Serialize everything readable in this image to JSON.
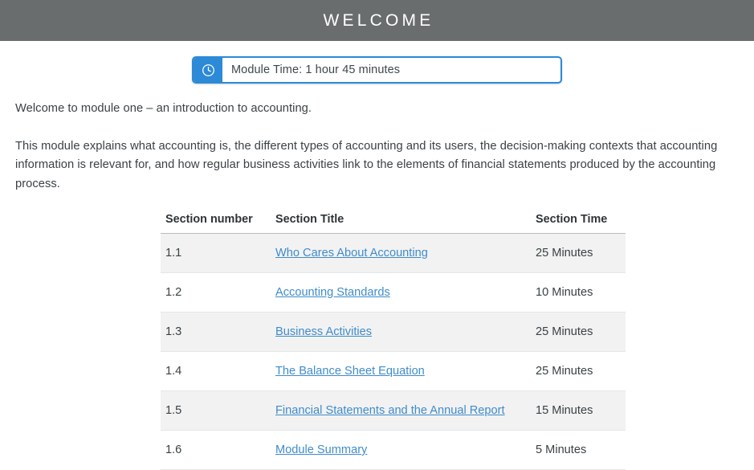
{
  "header": {
    "title": "WELCOME"
  },
  "module_time": {
    "icon": "clock-icon",
    "label": "Module Time: 1 hour 45 minutes"
  },
  "intro": {
    "paragraph_1": "Welcome to module one – an introduction to accounting.",
    "paragraph_2": "This module explains what accounting is, the different types of accounting and its users, the decision-making contexts that accounting information is relevant for, and how regular business activities link to the elements of financial statements produced by the accounting process."
  },
  "sections_table": {
    "columns": [
      "Section number",
      "Section Title",
      "Section Time"
    ],
    "rows": [
      {
        "number": "1.1",
        "title": "Who Cares About Accounting",
        "time": "25 Minutes"
      },
      {
        "number": "1.2",
        "title": "Accounting Standards",
        "time": "10 Minutes"
      },
      {
        "number": "1.3",
        "title": "Business Activities",
        "time": "25 Minutes"
      },
      {
        "number": "1.4",
        "title": "The Balance Sheet Equation",
        "time": "25 Minutes"
      },
      {
        "number": "1.5",
        "title": "Financial Statements and the Annual Report",
        "time": "15 Minutes"
      },
      {
        "number": "1.6",
        "title": "Module Summary",
        "time": "5 Minutes"
      }
    ]
  },
  "colors": {
    "header_bar": "#6a6d6e",
    "accent_blue": "#2c8ad6",
    "link_blue": "#3f8ccb",
    "row_stripe": "#f2f2f2",
    "body_text": "#3a4145"
  }
}
